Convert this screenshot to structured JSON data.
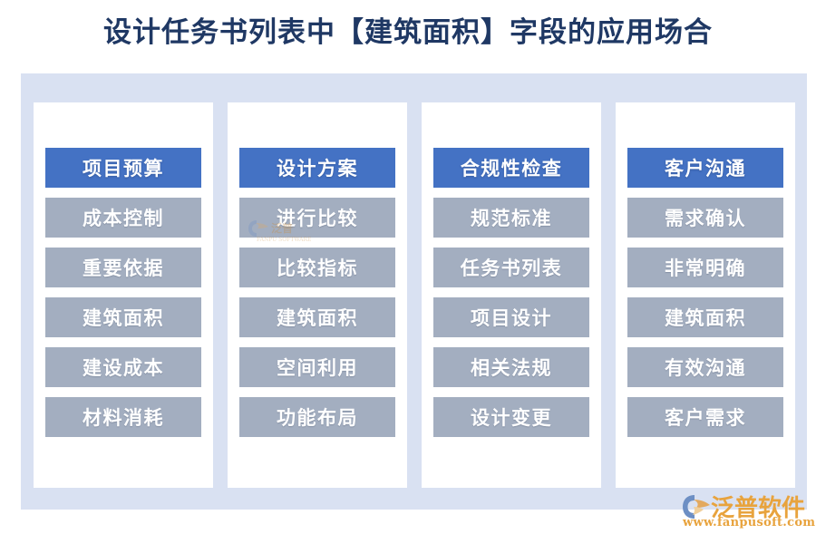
{
  "page": {
    "title": "设计任务书列表中【建筑面积】字段的应用场合",
    "background_color": "#ffffff",
    "panel_color": "#d9e1f2",
    "card_color": "#ffffff",
    "header_color": "#4472c4",
    "item_color": "#a3aec0",
    "title_color": "#1f3864",
    "brand_color": "#e8a33d"
  },
  "columns": [
    {
      "header": "项目预算",
      "items": [
        "成本控制",
        "重要依据",
        "建筑面积",
        "建设成本",
        "材料消耗"
      ]
    },
    {
      "header": "设计方案",
      "items": [
        "进行比较",
        "比较指标",
        "建筑面积",
        "空间利用",
        "功能布局"
      ]
    },
    {
      "header": "合规性检查",
      "items": [
        "规范标准",
        "任务书列表",
        "项目设计",
        "相关法规",
        "设计变更"
      ]
    },
    {
      "header": "客户沟通",
      "items": [
        "需求确认",
        "非常明确",
        "建筑面积",
        "有效沟通",
        "客户需求"
      ]
    }
  ],
  "brand": {
    "name": "泛普软件",
    "url": "www.fanpusoft.com",
    "mark": "fanpu-swoosh-icon"
  }
}
